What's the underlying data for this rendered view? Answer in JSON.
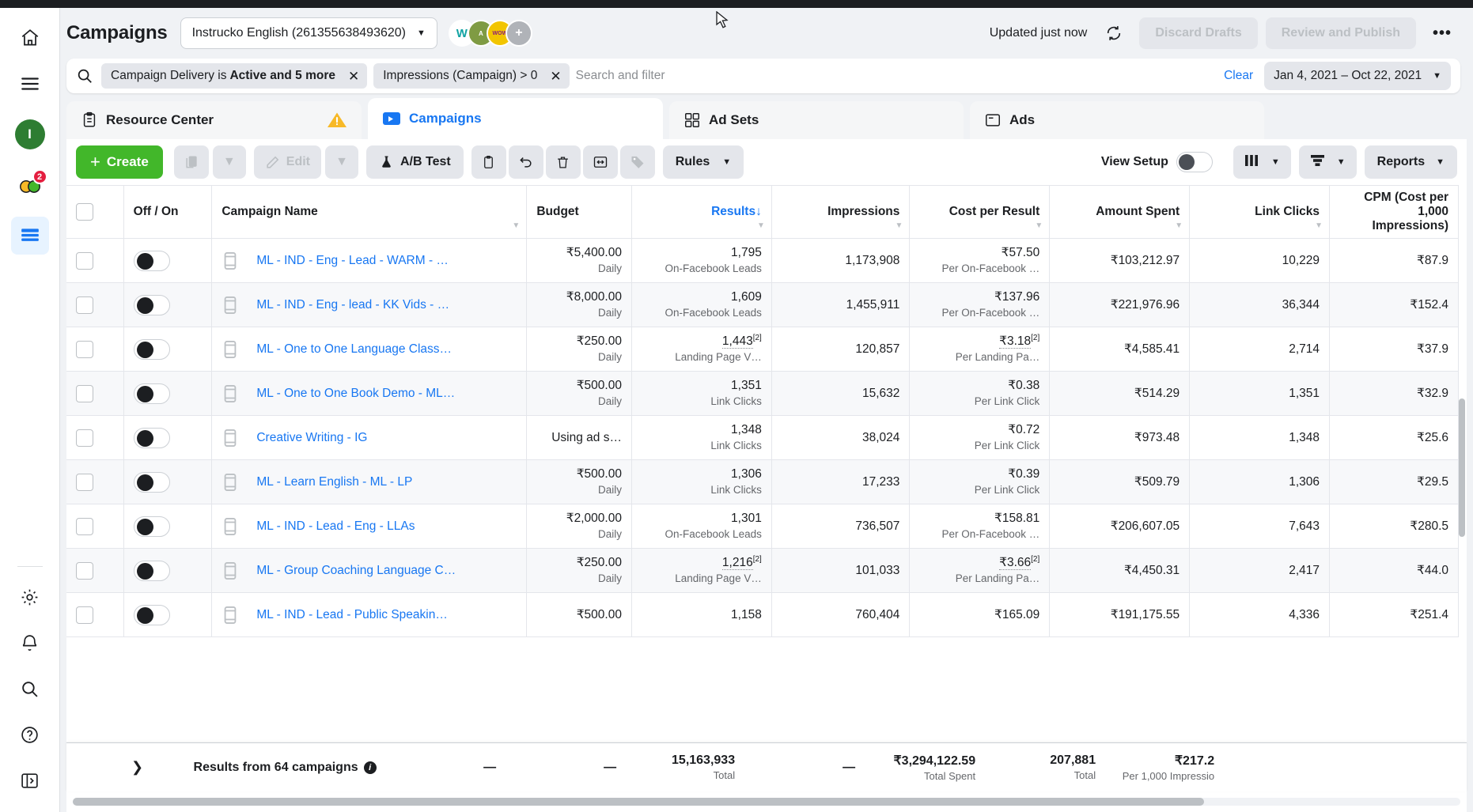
{
  "header": {
    "title": "Campaigns",
    "account_select": {
      "value": "Instrucko English (261355638493620)",
      "caret": "chevron-down-icon"
    },
    "updated_text": "Updated just now",
    "refresh_icon": "refresh-icon",
    "discard_label": "Discard Drafts",
    "publish_label": "Review and Publish",
    "more_label": "•••",
    "avatars": [
      {
        "initial": "W",
        "bg": "#ffffff",
        "fg": "#11a3a3",
        "name": "instrucko-logo"
      },
      {
        "initial": "A",
        "bg": "#7f9b43",
        "fg": "#ffffff",
        "name": "brand-avatar-2"
      },
      {
        "initial": "WOW",
        "bg": "#f2c500",
        "fg": "#8a1c7c",
        "name": "wow-avatar"
      },
      {
        "initial": "+",
        "bg": "#b0b3b8",
        "fg": "#ffffff",
        "name": "add-avatar"
      }
    ]
  },
  "filterbar": {
    "search_icon": "search-icon",
    "pills": [
      {
        "text": "Campaign Delivery is ",
        "bold": "Active and 5 more",
        "close": "close-icon"
      },
      {
        "text": "Impressions (Campaign) > 0",
        "bold": "",
        "close": "close-icon"
      }
    ],
    "search_value": "",
    "search_placeholder": "Search and filter",
    "clear_label": "Clear",
    "date_range": "Jan 4, 2021 – Oct 22, 2021"
  },
  "tabs": [
    {
      "label": "Resource Center",
      "icon": "clipboard-icon",
      "active": false,
      "warning": "warning-triangle-icon"
    },
    {
      "label": "Campaigns",
      "icon": "megaphone-icon",
      "active": true,
      "warning": ""
    },
    {
      "label": "Ad Sets",
      "icon": "adsets-grid-icon",
      "active": false,
      "warning": ""
    },
    {
      "label": "Ads",
      "icon": "ads-window-icon",
      "active": false,
      "warning": ""
    }
  ],
  "toolbar": {
    "create_label": "Create",
    "duplicate_icon": "duplicate-icon",
    "duplicate_caret": "chevron-down-icon",
    "edit_label": "Edit",
    "edit_icon": "pencil-icon",
    "edit_caret": "chevron-down-icon",
    "abtest_label": "A/B Test",
    "abtest_icon": "flask-icon",
    "clipboard_icon": "clipboard-paste-icon",
    "undo_icon": "undo-icon",
    "delete_icon": "trash-icon",
    "export_icon": "exchange-icon",
    "tag_icon": "tag-icon",
    "rules_label": "Rules",
    "view_setup_label": "View Setup",
    "view_setup_on": false,
    "columns_icon": "columns-icon",
    "breakdown_icon": "breakdown-icon",
    "reports_label": "Reports"
  },
  "table": {
    "columns": [
      {
        "key": "check",
        "label": "",
        "align": "left",
        "caret": false,
        "sorted": false
      },
      {
        "key": "offon",
        "label": "Off / On",
        "align": "left",
        "caret": false,
        "sorted": false
      },
      {
        "key": "name",
        "label": "Campaign Name",
        "align": "left",
        "caret": true,
        "sorted": false
      },
      {
        "key": "budget",
        "label": "Budget",
        "align": "left",
        "caret": false,
        "sorted": false
      },
      {
        "key": "results",
        "label": "Results",
        "align": "right",
        "caret": true,
        "sorted": true,
        "sort_arrow": "↓"
      },
      {
        "key": "impressions",
        "label": "Impressions",
        "align": "right",
        "caret": true,
        "sorted": false
      },
      {
        "key": "cpr",
        "label": "Cost per Result",
        "align": "right",
        "caret": true,
        "sorted": false
      },
      {
        "key": "spent",
        "label": "Amount Spent",
        "align": "right",
        "caret": true,
        "sorted": false
      },
      {
        "key": "clicks",
        "label": "Link Clicks",
        "align": "right",
        "caret": true,
        "sorted": false
      },
      {
        "key": "cpm",
        "label": "CPM (Cost per 1,000 Impressions)",
        "align": "right",
        "caret": false,
        "sorted": false
      }
    ],
    "rows": [
      {
        "name": "ML - IND - Eng - Lead - WARM - …",
        "budget": "₹5,400.00",
        "budget_sub": "Daily",
        "results": "1,795",
        "results_sub": "On-Facebook Leads",
        "results_dotted": false,
        "results_sup": "",
        "impressions": "1,173,908",
        "cpr": "₹57.50",
        "cpr_sub": "Per On-Facebook …",
        "cpr_dotted": false,
        "cpr_sup": "",
        "spent": "₹103,212.97",
        "clicks": "10,229",
        "cpm": "₹87.9"
      },
      {
        "name": "ML - IND - Eng - lead - KK Vids - …",
        "budget": "₹8,000.00",
        "budget_sub": "Daily",
        "results": "1,609",
        "results_sub": "On-Facebook Leads",
        "results_dotted": false,
        "results_sup": "",
        "impressions": "1,455,911",
        "cpr": "₹137.96",
        "cpr_sub": "Per On-Facebook …",
        "cpr_dotted": false,
        "cpr_sup": "",
        "spent": "₹221,976.96",
        "clicks": "36,344",
        "cpm": "₹152.4"
      },
      {
        "name": "ML - One to One Language Class…",
        "budget": "₹250.00",
        "budget_sub": "Daily",
        "results": "1,443",
        "results_sub": "Landing Page V…",
        "results_dotted": true,
        "results_sup": "[2]",
        "impressions": "120,857",
        "cpr": "₹3.18",
        "cpr_sub": "Per Landing Pa…",
        "cpr_dotted": true,
        "cpr_sup": "[2]",
        "spent": "₹4,585.41",
        "clicks": "2,714",
        "cpm": "₹37.9"
      },
      {
        "name": "ML - One to One Book Demo - ML…",
        "budget": "₹500.00",
        "budget_sub": "Daily",
        "results": "1,351",
        "results_sub": "Link Clicks",
        "results_dotted": false,
        "results_sup": "",
        "impressions": "15,632",
        "cpr": "₹0.38",
        "cpr_sub": "Per Link Click",
        "cpr_dotted": false,
        "cpr_sup": "",
        "spent": "₹514.29",
        "clicks": "1,351",
        "cpm": "₹32.9"
      },
      {
        "name": "Creative Writing - IG",
        "budget": "Using ad s…",
        "budget_sub": "",
        "results": "1,348",
        "results_sub": "Link Clicks",
        "results_dotted": false,
        "results_sup": "",
        "impressions": "38,024",
        "cpr": "₹0.72",
        "cpr_sub": "Per Link Click",
        "cpr_dotted": false,
        "cpr_sup": "",
        "spent": "₹973.48",
        "clicks": "1,348",
        "cpm": "₹25.6"
      },
      {
        "name": "ML - Learn English - ML - LP",
        "budget": "₹500.00",
        "budget_sub": "Daily",
        "results": "1,306",
        "results_sub": "Link Clicks",
        "results_dotted": false,
        "results_sup": "",
        "impressions": "17,233",
        "cpr": "₹0.39",
        "cpr_sub": "Per Link Click",
        "cpr_dotted": false,
        "cpr_sup": "",
        "spent": "₹509.79",
        "clicks": "1,306",
        "cpm": "₹29.5"
      },
      {
        "name": "ML - IND - Lead - Eng - LLAs",
        "budget": "₹2,000.00",
        "budget_sub": "Daily",
        "results": "1,301",
        "results_sub": "On-Facebook Leads",
        "results_dotted": false,
        "results_sup": "",
        "impressions": "736,507",
        "cpr": "₹158.81",
        "cpr_sub": "Per On-Facebook …",
        "cpr_dotted": false,
        "cpr_sup": "",
        "spent": "₹206,607.05",
        "clicks": "7,643",
        "cpm": "₹280.5"
      },
      {
        "name": "ML - Group Coaching Language C…",
        "budget": "₹250.00",
        "budget_sub": "Daily",
        "results": "1,216",
        "results_sub": "Landing Page V…",
        "results_dotted": true,
        "results_sup": "[2]",
        "impressions": "101,033",
        "cpr": "₹3.66",
        "cpr_sub": "Per Landing Pa…",
        "cpr_dotted": true,
        "cpr_sup": "[2]",
        "spent": "₹4,450.31",
        "clicks": "2,417",
        "cpm": "₹44.0"
      },
      {
        "name": "ML - IND - Lead - Public Speakin…",
        "budget": "₹500.00",
        "budget_sub": "",
        "results": "1,158",
        "results_sub": "",
        "results_dotted": false,
        "results_sup": "",
        "impressions": "760,404",
        "cpr": "₹165.09",
        "cpr_sub": "",
        "cpr_dotted": false,
        "cpr_sup": "",
        "spent": "₹191,175.55",
        "clicks": "4,336",
        "cpm": "₹251.4"
      }
    ],
    "summary": {
      "expand_icon": "chevron-right-icon",
      "label": "Results from 64 campaigns",
      "info_icon": "info-icon",
      "budget": "—",
      "results": "—",
      "impressions": "15,163,933",
      "impressions_sub": "Total",
      "cpr": "—",
      "spent": "₹3,294,122.59",
      "spent_sub": "Total Spent",
      "clicks": "207,881",
      "clicks_sub": "Total",
      "cpm": "₹217.2",
      "cpm_sub": "Per 1,000 Impressio"
    }
  },
  "rail": {
    "home_icon": "home-icon",
    "menu_icon": "hamburger-menu-icon",
    "profile_initial": "I",
    "notifications_icon": "faces-icon",
    "notifications_badge": "2",
    "table_icon": "table-view-icon",
    "settings_icon": "gear-icon",
    "bell_icon": "bell-icon",
    "search_icon": "search-icon",
    "help_icon": "help-icon",
    "collapse_icon": "collapse-panel-icon"
  },
  "colors": {
    "accent": "#1877f2",
    "create_green": "#42b72a",
    "warning": "#f7b928",
    "danger": "#e41e3f"
  }
}
